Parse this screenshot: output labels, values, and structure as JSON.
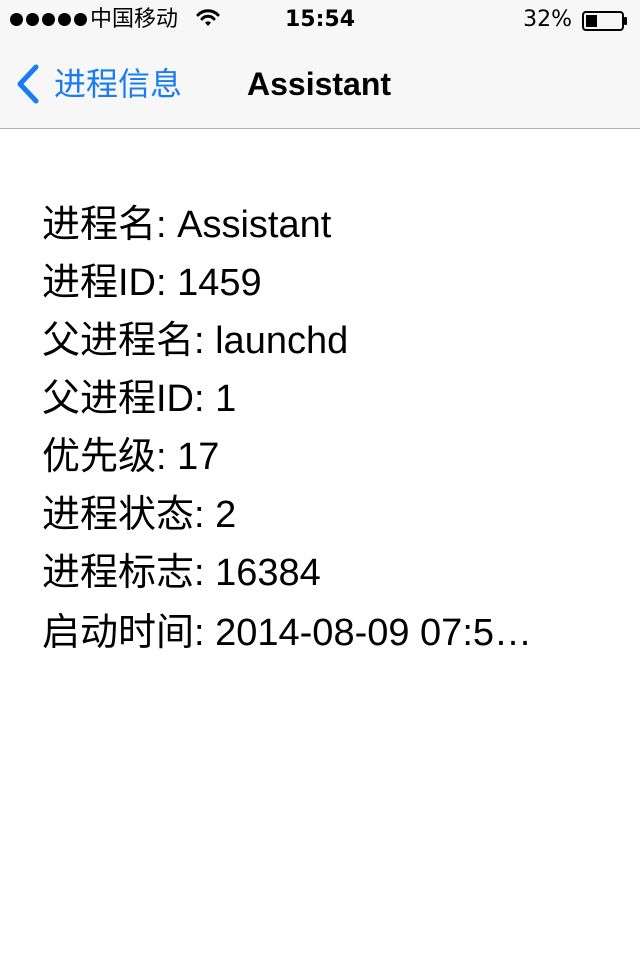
{
  "status_bar": {
    "carrier": "中国移动",
    "time": "15:54",
    "battery_percent": "32%",
    "battery_level": 0.32,
    "signal_bars": 5,
    "icons": [
      "signal-dots-icon",
      "wifi-icon",
      "battery-icon"
    ]
  },
  "nav": {
    "back_label": "进程信息",
    "title": "Assistant"
  },
  "colors": {
    "accent": "#1a7cf2",
    "bar_background": "#f7f7f7",
    "separator": "#b2b2b2"
  },
  "info": [
    {
      "label": "进程名",
      "value": "Assistant",
      "text": "进程名: Assistant"
    },
    {
      "label": "进程ID",
      "value": "1459",
      "text": "进程ID: 1459"
    },
    {
      "label": "父进程名",
      "value": "launchd",
      "text": "父进程名: launchd"
    },
    {
      "label": "父进程ID",
      "value": "1",
      "text": "父进程ID: 1"
    },
    {
      "label": "优先级",
      "value": "17",
      "text": "优先级: 17"
    },
    {
      "label": "进程状态",
      "value": "2",
      "text": "进程状态: 2"
    },
    {
      "label": "进程标志",
      "value": "16384",
      "text": "进程标志: 16384"
    },
    {
      "label": "启动时间",
      "value": "2014-08-09 07:5…",
      "text": "启动时间: 2014-08-09 07:5…"
    }
  ]
}
